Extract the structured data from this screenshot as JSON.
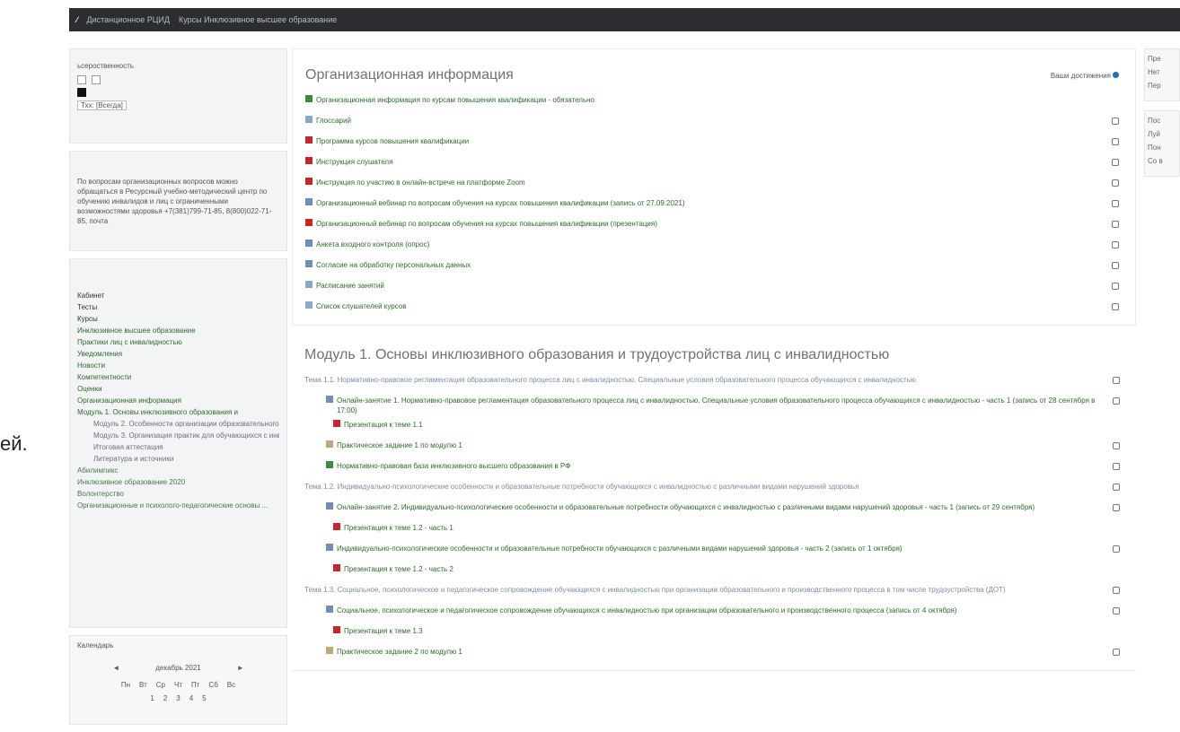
{
  "topbar": {
    "brand": "⁄",
    "crumbs": [
      "Дистанционное РЦИД",
      "Курсы Инклюзивное высшее образование"
    ]
  },
  "outside_text": "ей.",
  "left": {
    "block1": {
      "line1": "ьсероственность",
      "select": "Тхх: [Всегда]"
    },
    "block2": {
      "text": "По вопросам организационных вопросов можно обращаться в Ресурсный учебно-методический центр по обучению инвалидов и лиц с ограниченными возможностями здоровья +7(381)799-71-85, 8(800)022-71-85, почта"
    },
    "nav": [
      {
        "label": "Кабинет",
        "cls": "dark"
      },
      {
        "label": "Тесты",
        "cls": "dark"
      },
      {
        "label": "Курсы",
        "cls": "dark"
      },
      {
        "label": "Инклюзивное высшее образование",
        "cls": "link"
      },
      {
        "label": "Практики лиц с инвалидностью",
        "cls": "link"
      },
      {
        "label": "Уведомления",
        "cls": "link"
      },
      {
        "label": "Новости",
        "cls": "link"
      },
      {
        "label": "Компетентности",
        "cls": "link"
      },
      {
        "label": "Оценки",
        "cls": "link"
      },
      {
        "label": "Организационная информация",
        "cls": "link"
      },
      {
        "label": "Модуль 1. Основы инклюзивного образования и",
        "cls": "link"
      },
      {
        "label": "Модуль 2. Особенности организации образовательного...",
        "cls": "sub"
      },
      {
        "label": "Модуль 3. Организация практик для обучающихся с инв...",
        "cls": "sub"
      },
      {
        "label": "Итоговая аттестация",
        "cls": "sub"
      },
      {
        "label": "Литература и источники",
        "cls": "sub"
      },
      {
        "label": "Абилимпикс",
        "cls": "top"
      },
      {
        "label": "Инклюзивное образование 2020",
        "cls": "top"
      },
      {
        "label": "Волонтерство",
        "cls": "top"
      },
      {
        "label": "Организационные и психолого-педагогические основы ...",
        "cls": "top"
      }
    ],
    "calendar": {
      "title": "Календарь",
      "prev": "◄",
      "month": "декабрь 2021",
      "next": "►",
      "days": [
        "Пн",
        "Вт",
        "Ср",
        "Чт",
        "Пт",
        "Сб",
        "Вс"
      ],
      "nums": [
        "1",
        "2",
        "3",
        "4",
        "5"
      ]
    }
  },
  "main": {
    "sections": [
      {
        "title": "Организационная информация",
        "access": "Ваши достижения",
        "rows": [
          {
            "icon": "xls",
            "text": "Организационная информация по курсам повышения квалификации - обязательно",
            "check": false,
            "indent": ""
          },
          {
            "icon": "doc",
            "text": "Глоссарий",
            "check": true,
            "indent": ""
          },
          {
            "icon": "pdf",
            "text": "Программа курсов повышения квалификации",
            "check": true,
            "indent": ""
          },
          {
            "icon": "pdf",
            "text": "Инструкция слушателя",
            "check": true,
            "indent": ""
          },
          {
            "icon": "pdf",
            "text": "Инструкция по участию в онлайн-встрече на платформе Zoom",
            "check": true,
            "indent": ""
          },
          {
            "icon": "url",
            "text": "Организационный вебинар по вопросам обучения на курсах повышения квалификации (запись от 27.09.2021)",
            "check": true,
            "indent": ""
          },
          {
            "icon": "pdf",
            "text": "Организационный вебинар по вопросам обучения на курсах повышения квалификации (презентация)",
            "check": true,
            "indent": ""
          },
          {
            "icon": "url",
            "text": "Анкета входного контроля (опрос)",
            "check": true,
            "indent": ""
          },
          {
            "icon": "url",
            "text": "Согласие на обработку персональных данных",
            "check": true,
            "indent": ""
          },
          {
            "icon": "doc",
            "text": "Расписание занятий",
            "check": true,
            "indent": ""
          },
          {
            "icon": "doc",
            "text": "Список слушателей курсов",
            "check": true,
            "indent": ""
          }
        ]
      },
      {
        "title": "Модуль 1. Основы инклюзивного образования и трудоустройства лиц с инвалидностью",
        "access": "",
        "rows": [
          {
            "icon": "",
            "text": "Тема 1.1. Нормативно-правовое регламентация образовательного процесса лиц с инвалидностью. Специальные условия образовательного процесса обучающихся с инвалидностью",
            "check": true,
            "indent": "topic"
          },
          {
            "icon": "url",
            "text": "Онлайн-занятие 1. Нормативно-правовое регламентация образовательного процесса лиц с инвалидностью. Специальные условия образовательного процесса обучающихся с инвалидностью - часть 1 (запись от 28 сентября в 17:00)",
            "check": true,
            "indent": "sub"
          },
          {
            "icon": "pdf",
            "text": "Презентация к теме 1.1",
            "check": false,
            "indent": "sub2"
          },
          {
            "icon": "zip",
            "text": "Практическое задание 1 по модулю 1",
            "check": true,
            "indent": "sub"
          },
          {
            "icon": "xls",
            "text": "Нормативно-правовая база инклюзивного высшего образования в РФ",
            "check": true,
            "indent": "sub"
          },
          {
            "icon": "",
            "text": "Тема 1.2. Индивидуально-психологические особенности и образовательные потребности обучающихся с инвалидностью с различными видами нарушений здоровья",
            "check": true,
            "indent": "topic"
          },
          {
            "icon": "url",
            "text": "Онлайн-занятие 2. Индивидуально-психологические особенности и образовательные потребности обучающихся с инвалидностью с различными видами нарушений здоровья - часть 1 (запись от 29 сентября)",
            "check": true,
            "indent": "sub"
          },
          {
            "icon": "pdf",
            "text": "Презентация к теме 1.2 - часть 1",
            "check": false,
            "indent": "sub2"
          },
          {
            "icon": "url",
            "text": "Индивидуально-психологические особенности и образовательные потребности обучающихся с различными видами нарушений здоровья - часть 2 (запись от 1 октября)",
            "check": true,
            "indent": "sub"
          },
          {
            "icon": "pdf",
            "text": "Презентация к теме 1.2 - часть 2",
            "check": false,
            "indent": "sub2"
          },
          {
            "icon": "",
            "text": "Тема 1.3. Социальное, психологическое и педагогическое сопровождение обучающихся с инвалидностью при организации образовательного и производственного процесса в том числе трудоустройства (ДОТ)",
            "check": true,
            "indent": "topic"
          },
          {
            "icon": "url",
            "text": "Социальное, психологическое и педагогическое сопровождение обучающихся с инвалидностью при организации образовательного и производственного процесса (запись от 4 октября)",
            "check": true,
            "indent": "sub"
          },
          {
            "icon": "pdf",
            "text": "Презентация к теме 1.3",
            "check": false,
            "indent": "sub2"
          },
          {
            "icon": "zip",
            "text": "Практическое задание 2 по модулю 1",
            "check": true,
            "indent": "sub"
          }
        ]
      }
    ]
  },
  "right": {
    "block1": [
      "Пре",
      "Нет",
      "Пер"
    ],
    "block2": [
      "Пос",
      "Луй",
      "Пон",
      "Со в"
    ]
  }
}
